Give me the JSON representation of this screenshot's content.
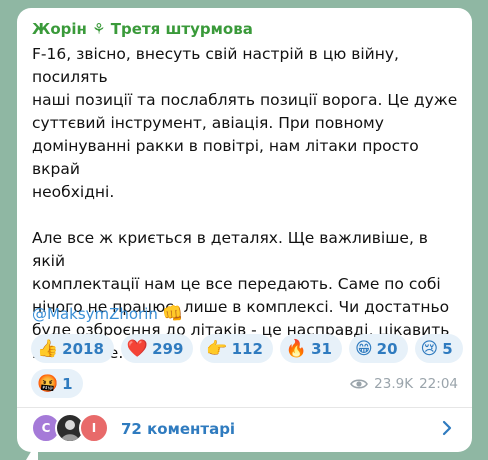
{
  "post": {
    "channel": "Жорін ⚘ Третя штурмова",
    "paragraph1": "F-16, звісно, внесуть свій настрій в цю війну, посилять\nнаші позиції та послаблять позиції ворога. Це дуже\nсуттєвий інструмент, авіація. При повному\nдомінуванні ракки в повітрі, нам літаки просто вкрай\nнеобхідні.",
    "paragraph2": "Але все ж криється в деталях. Ще важливіше, в якій\nкомплектації нам це все передають. Саме по собі\nнічого не працює, лише в комплексі. Чи достатньо\nбуде озброєння до літаків - це насправді, цікавить\nнайбільше.",
    "mention": "@MaksymZhorin",
    "mention_emoji": "👊"
  },
  "reactions": [
    {
      "icon": "thumbs-up-icon",
      "emoji": "👍",
      "count": "2018"
    },
    {
      "icon": "heart-icon",
      "emoji": "❤️",
      "count": "299"
    },
    {
      "icon": "point-right-icon",
      "emoji": "👉",
      "count": "112"
    },
    {
      "icon": "fire-icon",
      "emoji": "🔥",
      "count": "31"
    },
    {
      "icon": "grin-icon",
      "emoji": "😁",
      "count": "20"
    },
    {
      "icon": "crying-face-icon",
      "emoji": "😢",
      "count": "5"
    },
    {
      "icon": "angry-face-icon",
      "emoji": "🤬",
      "count": "1"
    }
  ],
  "meta": {
    "views": "23.9K",
    "time": "22:04"
  },
  "comments": {
    "label": "72 коментарі",
    "avatars": [
      {
        "initial": "C",
        "color": "#a57ad8"
      },
      {
        "initial": "",
        "color": "#2c2c2c"
      },
      {
        "initial": "I",
        "color": "#e86a6a"
      }
    ]
  }
}
